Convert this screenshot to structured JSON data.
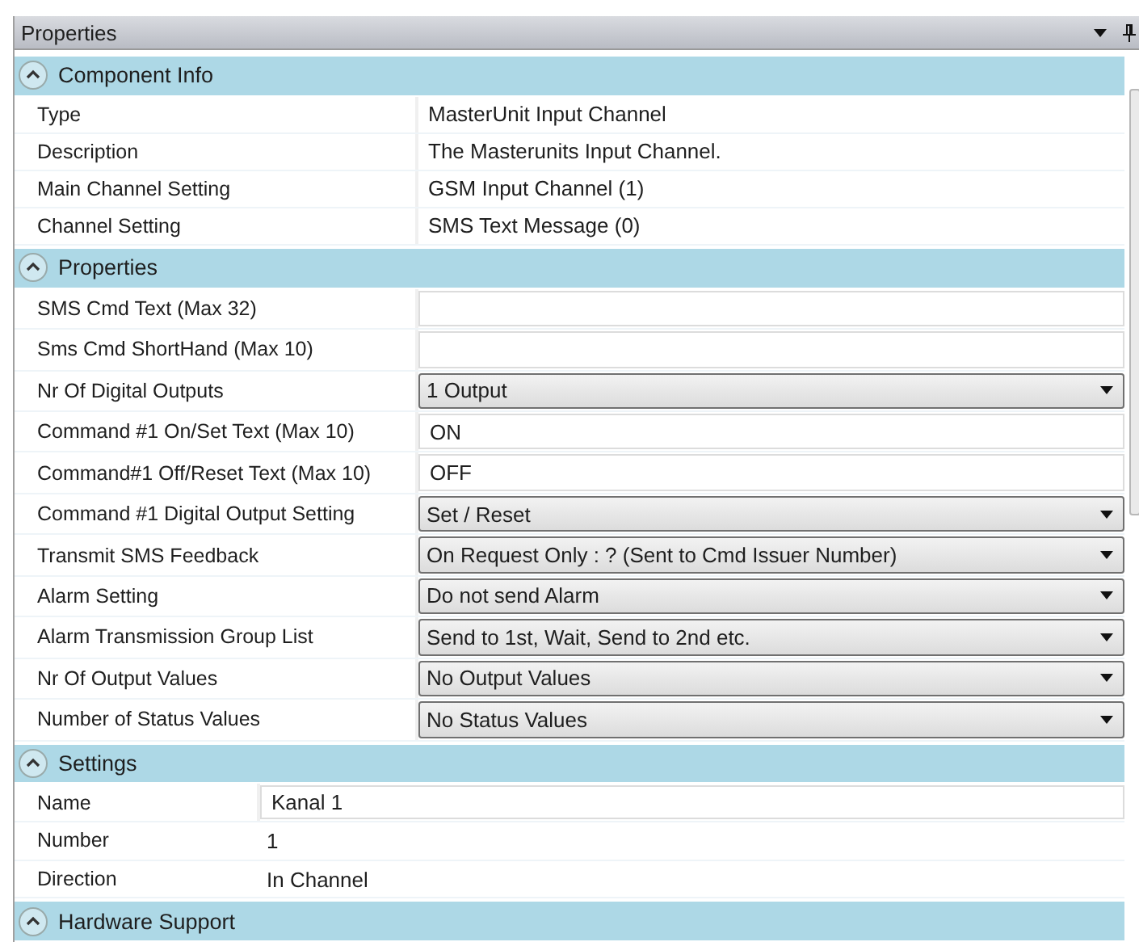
{
  "panel": {
    "title": "Properties"
  },
  "sections": [
    {
      "title": "Component Info",
      "expanded": true,
      "rows": [
        {
          "kind": "static",
          "label": "Type",
          "value": "MasterUnit Input Channel"
        },
        {
          "kind": "static",
          "label": "Description",
          "value": "The Masterunits Input Channel."
        },
        {
          "kind": "static",
          "label": "Main Channel Setting",
          "value": "GSM Input Channel (1)"
        },
        {
          "kind": "static",
          "label": "Channel Setting",
          "value": "SMS Text Message (0)"
        }
      ]
    },
    {
      "title": "Properties",
      "expanded": true,
      "rows": [
        {
          "kind": "text",
          "label": "SMS Cmd Text (Max 32)"
        },
        {
          "kind": "text",
          "label": "Sms Cmd ShortHand (Max 10)"
        },
        {
          "kind": "dropdown",
          "label": "Nr Of Digital Outputs",
          "value": "1 Output"
        },
        {
          "kind": "text",
          "label": "Command #1 On/Set Text (Max 10)",
          "value": "ON"
        },
        {
          "kind": "text",
          "label": "Command#1 Off/Reset Text (Max 10)",
          "value": "OFF"
        },
        {
          "kind": "dropdown",
          "label": "Command #1 Digital Output Setting",
          "value": "Set / Reset"
        },
        {
          "kind": "dropdown",
          "label": "Transmit SMS Feedback",
          "value": "On Request Only : ? (Sent to Cmd Issuer Number)"
        },
        {
          "kind": "dropdown",
          "label": "Alarm Setting",
          "value": "Do not send Alarm"
        },
        {
          "kind": "dropdown",
          "label": "Alarm Transmission Group List",
          "value": "Send to 1st, Wait, Send to 2nd etc."
        },
        {
          "kind": "dropdown",
          "label": "Nr Of Output Values",
          "value": "No Output Values"
        },
        {
          "kind": "dropdown",
          "label": "Number of Status Values",
          "value": "No Status Values"
        }
      ]
    },
    {
      "title": "Settings",
      "expanded": true,
      "rows": [
        {
          "kind": "text",
          "label": "Name",
          "value": "Kanal 1"
        },
        {
          "kind": "static",
          "label": "Number",
          "value": "1"
        },
        {
          "kind": "static",
          "label": "Direction",
          "value": "In Channel"
        }
      ]
    },
    {
      "title": "Hardware Support",
      "expanded": true
    }
  ]
}
